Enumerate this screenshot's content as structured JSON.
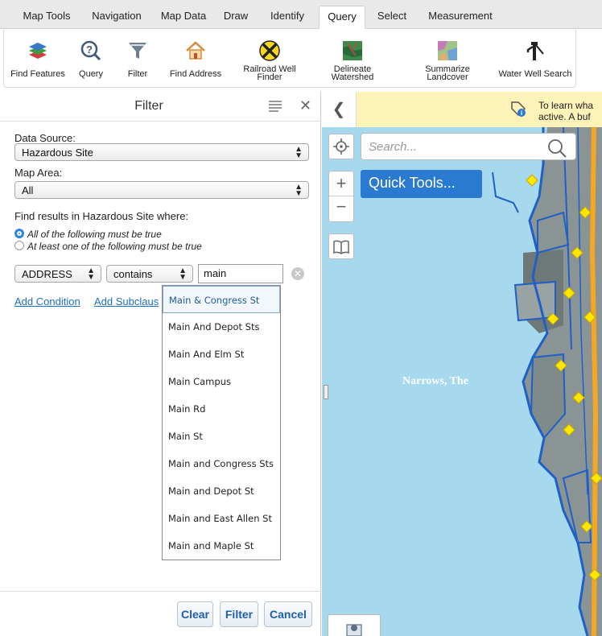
{
  "tabs": [
    {
      "label": "Map Tools",
      "active": false
    },
    {
      "label": "Navigation",
      "active": false
    },
    {
      "label": "Map Data",
      "active": false
    },
    {
      "label": "Draw",
      "active": false
    },
    {
      "label": "Identify",
      "active": false
    },
    {
      "label": "Query",
      "active": true
    },
    {
      "label": "Select",
      "active": false
    },
    {
      "label": "Measurement",
      "active": false
    }
  ],
  "ribbon": [
    {
      "label": "Find Features",
      "icon": "layers-icon"
    },
    {
      "label": "Query",
      "icon": "query-icon"
    },
    {
      "label": "Filter",
      "icon": "filter-icon"
    },
    {
      "label": "Find Address",
      "icon": "house-icon"
    },
    {
      "label": "Railroad Well Finder",
      "line1": "Railroad Well",
      "line2": "Finder",
      "icon": "railroad-crossing-icon"
    },
    {
      "label": "Delineate Watershed",
      "line1": "Delineate",
      "line2": "Watershed",
      "icon": "watershed-icon"
    },
    {
      "label": "Summarize Landcover",
      "line1": "Summarize",
      "line2": "Landcover",
      "icon": "landcover-icon"
    },
    {
      "label": "Water Well Search",
      "icon": "water-pump-icon"
    }
  ],
  "panel": {
    "title": "Filter",
    "data_source_label": "Data Source:",
    "data_source_value": "Hazardous Site",
    "map_area_label": "Map Area:",
    "map_area_value": "All",
    "find_results_label": "Find results in Hazardous Site where:",
    "radio_all": "All of the following must be true",
    "radio_any": "At least one of the following must be true",
    "condition": {
      "field": "ADDRESS",
      "operator": "contains",
      "value": "main"
    },
    "add_condition": "Add Condition",
    "add_subclause": "Add Subclaus",
    "suggestions": [
      "Main & Congress St",
      "Main And Depot Sts",
      "Main And Elm St",
      "Main Campus",
      "Main Rd",
      "Main St",
      "Main and Congress Sts",
      "Main and Depot St",
      "Main and East Allen St",
      "Main and Maple St"
    ],
    "buttons": {
      "clear": "Clear",
      "filter": "Filter",
      "cancel": "Cancel"
    }
  },
  "map": {
    "notice_line1": "To learn wha",
    "notice_line2": "active. A buf",
    "search_placeholder": "Search...",
    "quick_tools": "Quick Tools...",
    "place_label": "Narrows, The",
    "colors": {
      "water": "#a6d8ee",
      "land": "#7f8a8a",
      "road": "#f5a623",
      "marker": "#ffe600",
      "outline": "#1f5fc8"
    }
  }
}
